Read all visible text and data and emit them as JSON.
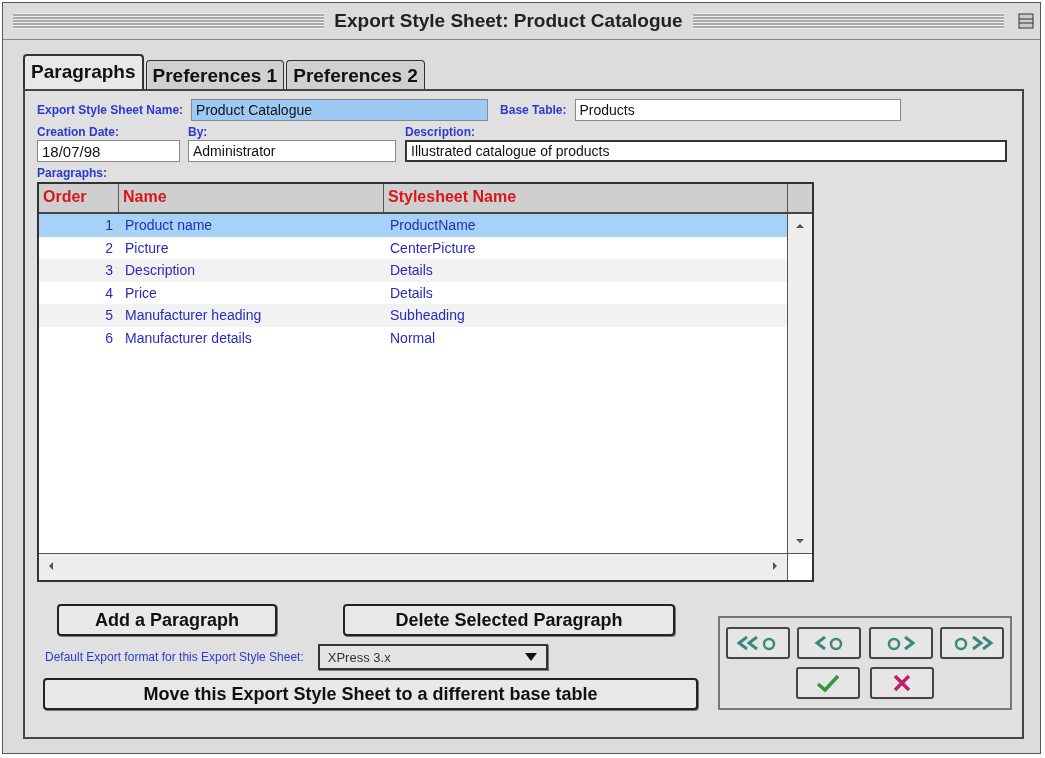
{
  "window": {
    "title": "Export Style Sheet: Product Catalogue"
  },
  "tabs": [
    {
      "label": "Paragraphs",
      "selected": true
    },
    {
      "label": "Preferences 1",
      "selected": false
    },
    {
      "label": "Preferences 2",
      "selected": false
    }
  ],
  "name_field": {
    "label": "Export Style Sheet  Name:",
    "value": "Product Catalogue",
    "selected": true
  },
  "base_table_field": {
    "label": "Base Table:",
    "value": "Products",
    "selected": false
  },
  "creation_date_field": {
    "label": "Creation Date:",
    "value": "18/07/98",
    "selected": false
  },
  "by_field": {
    "label": "By:",
    "value": "Administrator",
    "selected": false
  },
  "description_field": {
    "label": "Description:",
    "value": "Illustrated catalogue of products",
    "selected": false
  },
  "paragraphs_label": "Paragraphs:",
  "table": {
    "columns": [
      "Order",
      "Name",
      "Stylesheet Name"
    ],
    "rows": [
      {
        "order": "1",
        "name": "Product name",
        "stylesheet": "ProductName",
        "selected": true
      },
      {
        "order": "2",
        "name": "Picture",
        "stylesheet": "CenterPicture",
        "selected": false
      },
      {
        "order": "3",
        "name": "Description",
        "stylesheet": "Details",
        "selected": false
      },
      {
        "order": "4",
        "name": "Price",
        "stylesheet": "Details",
        "selected": false
      },
      {
        "order": "5",
        "name": "Manufacturer heading",
        "stylesheet": "Subheading",
        "selected": false
      },
      {
        "order": "6",
        "name": "Manufacturer details",
        "stylesheet": "Normal",
        "selected": false
      }
    ]
  },
  "add_button": "Add a Paragraph",
  "delete_button": "Delete Selected Paragraph",
  "format": {
    "label": "Default Export format for this Export Style Sheet:",
    "value": "XPress 3.x"
  },
  "move_button": "Move this Export Style Sheet to a different base table",
  "nav_buttons": [
    {
      "kind": "first"
    },
    {
      "kind": "previous"
    },
    {
      "kind": "next"
    },
    {
      "kind": "last"
    }
  ],
  "action_buttons": [
    {
      "kind": "accept"
    },
    {
      "kind": "cancel"
    }
  ]
}
